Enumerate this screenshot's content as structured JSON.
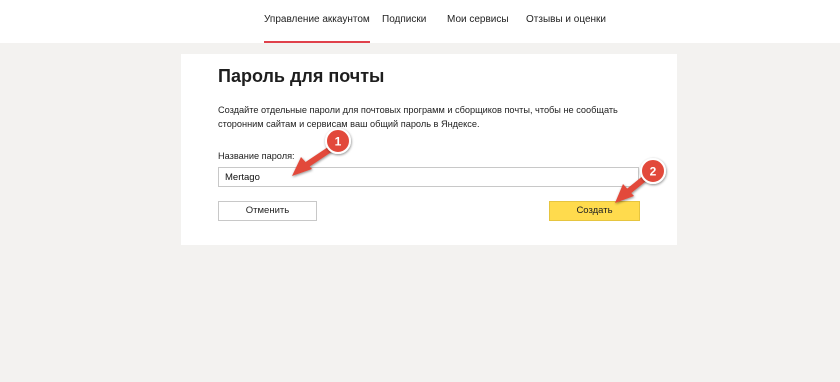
{
  "nav": {
    "tabs": [
      {
        "label": "Управление аккаунтом",
        "active": true
      },
      {
        "label": "Подписки",
        "active": false
      },
      {
        "label": "Мои сервисы",
        "active": false
      },
      {
        "label": "Отзывы и оценки",
        "active": false
      }
    ]
  },
  "dialog": {
    "title": "Пароль для почты",
    "description_line1": "Создайте отдельные пароли для почтовых программ и сборщиков почты, чтобы не сообщать",
    "description_line2": "сторонним сайтам и сервисам ваш общий пароль в Яндексе.",
    "field_label": "Название пароля:",
    "field_value": "Mertago",
    "cancel_label": "Отменить",
    "create_label": "Создать"
  },
  "annotations": {
    "badge1": "1",
    "badge2": "2"
  },
  "colors": {
    "accent_red": "#e0414b",
    "button_yellow": "#ffdb4d",
    "background": "#f3f2f0"
  }
}
